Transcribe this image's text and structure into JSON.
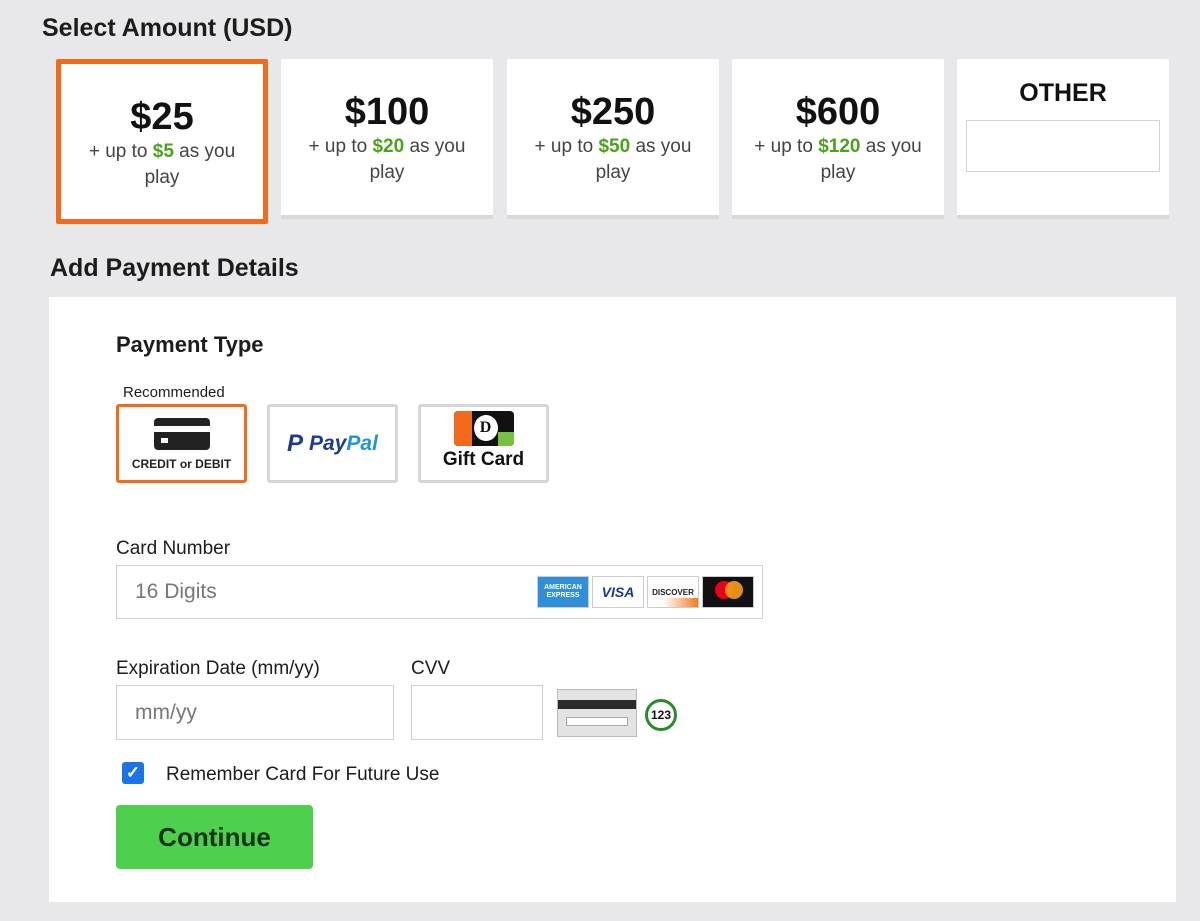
{
  "amount_section": {
    "title": "Select Amount (USD)",
    "options": [
      {
        "value": "$25",
        "bonus_prefix": "+ up to",
        "bonus": "$5",
        "bonus_suffix": "as you play",
        "selected": true
      },
      {
        "value": "$100",
        "bonus_prefix": "+ up to",
        "bonus": "$20",
        "bonus_suffix": "as you play",
        "selected": false
      },
      {
        "value": "$250",
        "bonus_prefix": "+ up to",
        "bonus": "$50",
        "bonus_suffix": "as you play",
        "selected": false
      },
      {
        "value": "$600",
        "bonus_prefix": "+ up to",
        "bonus": "$120",
        "bonus_suffix": "as you play",
        "selected": false
      }
    ],
    "other_label": "OTHER",
    "other_value": ""
  },
  "payment_section": {
    "title": "Add Payment Details",
    "payment_type_label": "Payment Type",
    "recommended_label": "Recommended",
    "methods": {
      "credit": "CREDIT or DEBIT",
      "paypal_pay": "Pay",
      "paypal_pal": "Pal",
      "paypal_mark": "P",
      "gift": "Gift Card",
      "gift_mark": "D"
    },
    "card_number_label": "Card Number",
    "card_number_placeholder": "16 Digits",
    "card_logos": {
      "amex": "AMERICAN EXPRESS",
      "visa": "VISA",
      "discover": "DISCOVER",
      "mastercard": "mastercard"
    },
    "expiration_label": "Expiration Date (mm/yy)",
    "expiration_placeholder": "mm/yy",
    "cvv_label": "CVV",
    "cvv_example": "123",
    "remember_label": "Remember Card For Future Use",
    "remember_checked": true,
    "continue_label": "Continue"
  },
  "colors": {
    "accent_orange": "#f26a1b",
    "bonus_green": "#4aa31b",
    "continue_green": "#4ecf4e",
    "checkbox_blue": "#1a73e8"
  }
}
